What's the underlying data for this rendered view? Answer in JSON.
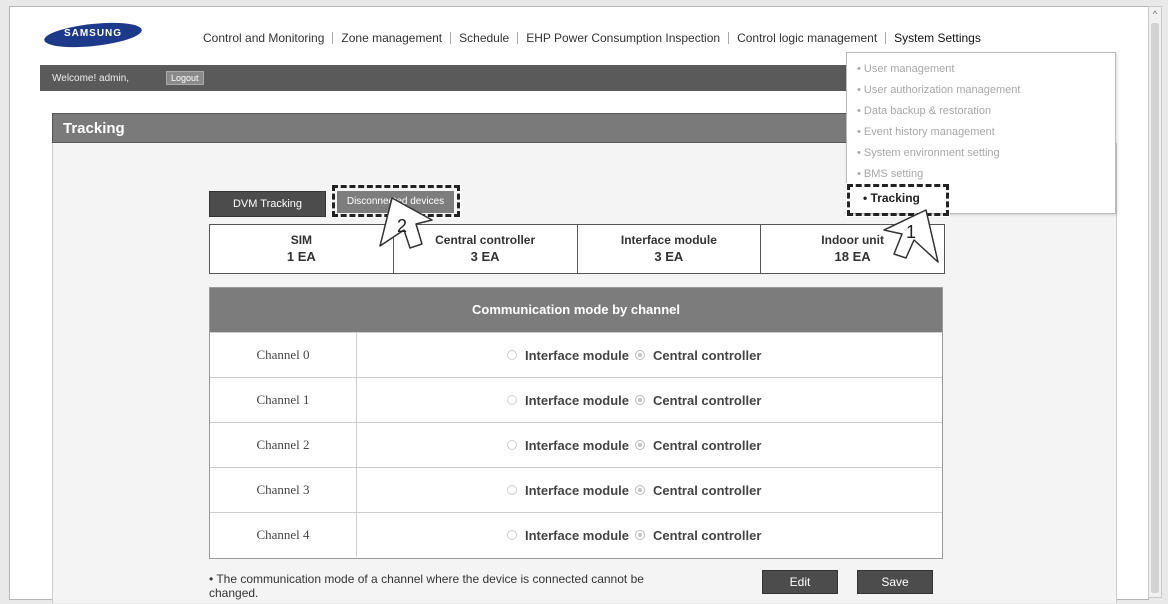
{
  "brand": {
    "logo_text": "SAMSUNG",
    "logo_color": "#1d3a8a"
  },
  "topnav": [
    "Control and Monitoring",
    "Zone management",
    "Schedule",
    "EHP Power Consumption Inspection",
    "Control logic management",
    "System Settings"
  ],
  "welcome": {
    "text": "Welcome! admin,",
    "logout_label": "Logout"
  },
  "page_title": "Tracking",
  "buttons": {
    "dvm_tracking": "DVM Tracking",
    "disconnected_devices": "Disconnected devices",
    "edit": "Edit",
    "save": "Save"
  },
  "counts": [
    {
      "label": "SIM",
      "value": "1 EA"
    },
    {
      "label": "Central controller",
      "value": "3 EA"
    },
    {
      "label": "Interface module",
      "value": "3 EA"
    },
    {
      "label": "Indoor unit",
      "value": "18 EA"
    }
  ],
  "comm_mode": {
    "header": "Communication mode by channel",
    "option_a": "Interface module",
    "option_b": "Central controller",
    "channels": [
      "Channel 0",
      "Channel 1",
      "Channel 2",
      "Channel 3",
      "Channel 4"
    ]
  },
  "note": "• The communication mode of a channel where the device is connected cannot be changed.",
  "dropdown": [
    "• User management",
    "• User authorization management",
    "• Data backup & restoration",
    "• Event history management",
    "• System environment setting",
    "• BMS setting",
    "• Tracking"
  ],
  "callouts": {
    "one": "1",
    "two": "2"
  }
}
